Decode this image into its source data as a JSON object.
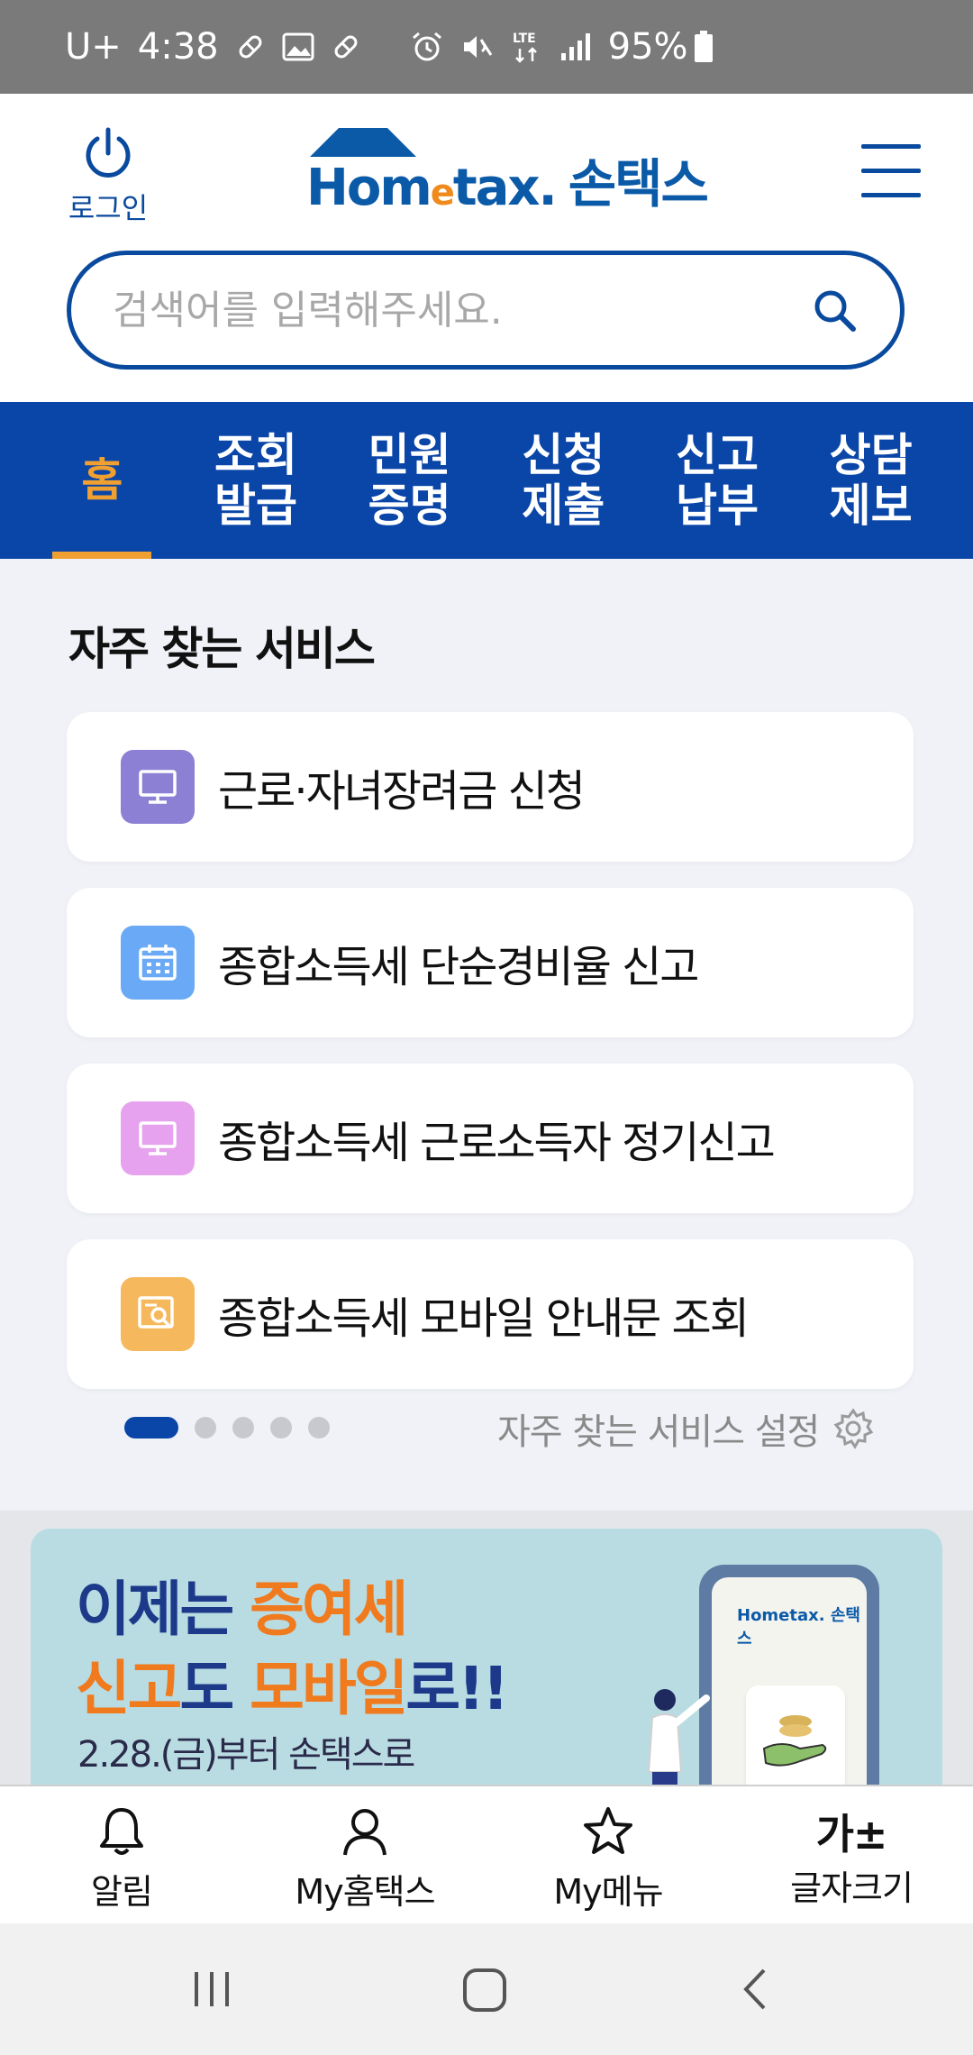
{
  "status_bar": {
    "carrier": "U+",
    "time": "4:38",
    "network": "LTE",
    "battery": "95%",
    "icons": [
      "pill-icon",
      "image-icon",
      "pill-icon",
      "alarm-icon",
      "mute-icon",
      "lte-icon",
      "signal-icon",
      "battery-icon"
    ]
  },
  "header": {
    "login_label": "로그인",
    "logo_home": "Hom",
    "logo_e": "e",
    "logo_tax": "tax.",
    "logo_brand": "손택스",
    "search_placeholder": "검색어를 입력해주세요."
  },
  "nav_tabs": [
    {
      "label": "홈",
      "active": true
    },
    {
      "label": "조회\n발급",
      "active": false
    },
    {
      "label": "민원\n증명",
      "active": false
    },
    {
      "label": "신청\n제출",
      "active": false
    },
    {
      "label": "신고\n납부",
      "active": false
    },
    {
      "label": "상담\n제보",
      "active": false
    }
  ],
  "favorites": {
    "title": "자주 찾는 서비스",
    "items": [
      {
        "label": "근로·자녀장려금 신청",
        "icon": "monitor-icon",
        "color": "#8b80d4"
      },
      {
        "label": "종합소득세 단순경비율 신고",
        "icon": "calendar-icon",
        "color": "#6aa9f5"
      },
      {
        "label": "종합소득세 근로소득자 정기신고",
        "icon": "monitor-icon",
        "color": "#e6a2ee"
      },
      {
        "label": "종합소득세 모바일 안내문 조회",
        "icon": "document-search-icon",
        "color": "#f6b85c"
      }
    ],
    "page_count": 5,
    "current_page": 1,
    "settings_label": "자주 찾는 서비스 설정"
  },
  "banner": {
    "line1_a": "이제는 ",
    "line1_b": "증여세",
    "line2_a": "신고",
    "line2_b": "도 ",
    "line2_c": "모바일",
    "line2_d": "로!!",
    "line3": "2.28.(금)부터 손택스로",
    "phone_logo": "Hometax. 손택스"
  },
  "bottom_nav": [
    {
      "label": "알림",
      "icon": "bell-icon"
    },
    {
      "label": "My홈택스",
      "icon": "person-icon"
    },
    {
      "label": "My메뉴",
      "icon": "star-icon"
    },
    {
      "label": "글자크기",
      "icon": "text-size-icon",
      "glyph": "가±"
    }
  ],
  "colors": {
    "primary": "#0a45a8",
    "accent": "#f0a030",
    "background": "#f0f2f7"
  }
}
